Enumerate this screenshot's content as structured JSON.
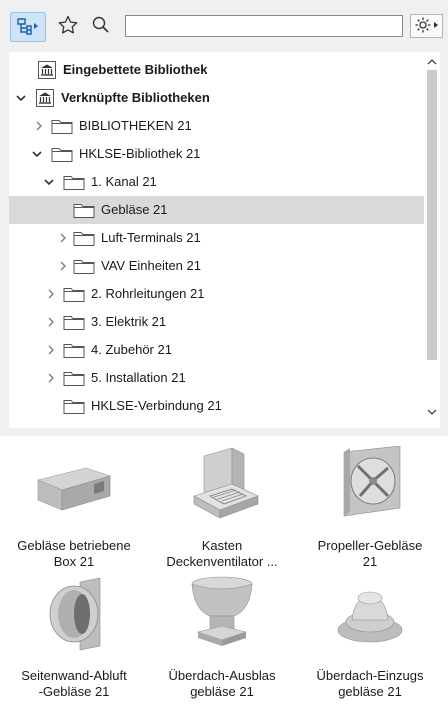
{
  "toolbar": {
    "search": {
      "value": "",
      "placeholder": ""
    },
    "icons": [
      "structure-view-icon",
      "favorites-star-icon",
      "search-magnifier-icon",
      "settings-gear-icon"
    ]
  },
  "tree": {
    "rows": [
      {
        "label": "Eingebettete Bibliothek",
        "bold": true,
        "icon": "library-icon",
        "expander": "none"
      },
      {
        "label": "Verknüpfte Bibliotheken",
        "bold": true,
        "icon": "library-icon",
        "expander": "expanded"
      },
      {
        "label": "BIBLIOTHEKEN 21",
        "icon": "folder-icon",
        "expander": "collapsed"
      },
      {
        "label": "HKLSE-Bibliothek 21",
        "icon": "folder-icon",
        "expander": "expanded"
      },
      {
        "label": "1. Kanal 21",
        "icon": "folder-icon",
        "expander": "expanded"
      },
      {
        "label": "Gebläse 21",
        "icon": "folder-icon",
        "expander": "none",
        "selected": true
      },
      {
        "label": "Luft-Terminals 21",
        "icon": "folder-icon",
        "expander": "collapsed"
      },
      {
        "label": "VAV Einheiten 21",
        "icon": "folder-icon",
        "expander": "collapsed"
      },
      {
        "label": "2. Rohrleitungen 21",
        "icon": "folder-icon",
        "expander": "collapsed"
      },
      {
        "label": "3. Elektrik 21",
        "icon": "folder-icon",
        "expander": "collapsed"
      },
      {
        "label": "4. Zubehör 21",
        "icon": "folder-icon",
        "expander": "collapsed"
      },
      {
        "label": "5. Installation 21",
        "icon": "folder-icon",
        "expander": "collapsed"
      },
      {
        "label": "HKLSE-Verbindung 21",
        "icon": "folder-icon",
        "expander": "none"
      }
    ]
  },
  "items": [
    {
      "line1": "Gebläse betriebene",
      "line2": "Box 21",
      "icon": "blower-box-thumbnail"
    },
    {
      "line1": "Kasten",
      "line2": "Deckenventilator ...",
      "icon": "ceiling-fan-box-thumbnail"
    },
    {
      "line1": "Propeller-Gebläse",
      "line2": "21",
      "icon": "propeller-fan-thumbnail"
    },
    {
      "line1": "Seitenwand-Abluft",
      "line2": "-Gebläse 21",
      "icon": "sidewall-exhaust-fan-thumbnail"
    },
    {
      "line1": "Überdach-Ausblas",
      "line2": "gebläse 21",
      "icon": "roof-exhaust-fan-thumbnail"
    },
    {
      "line1": "Überdach-Einzugs",
      "line2": "gebläse 21",
      "icon": "roof-intake-fan-thumbnail"
    }
  ]
}
